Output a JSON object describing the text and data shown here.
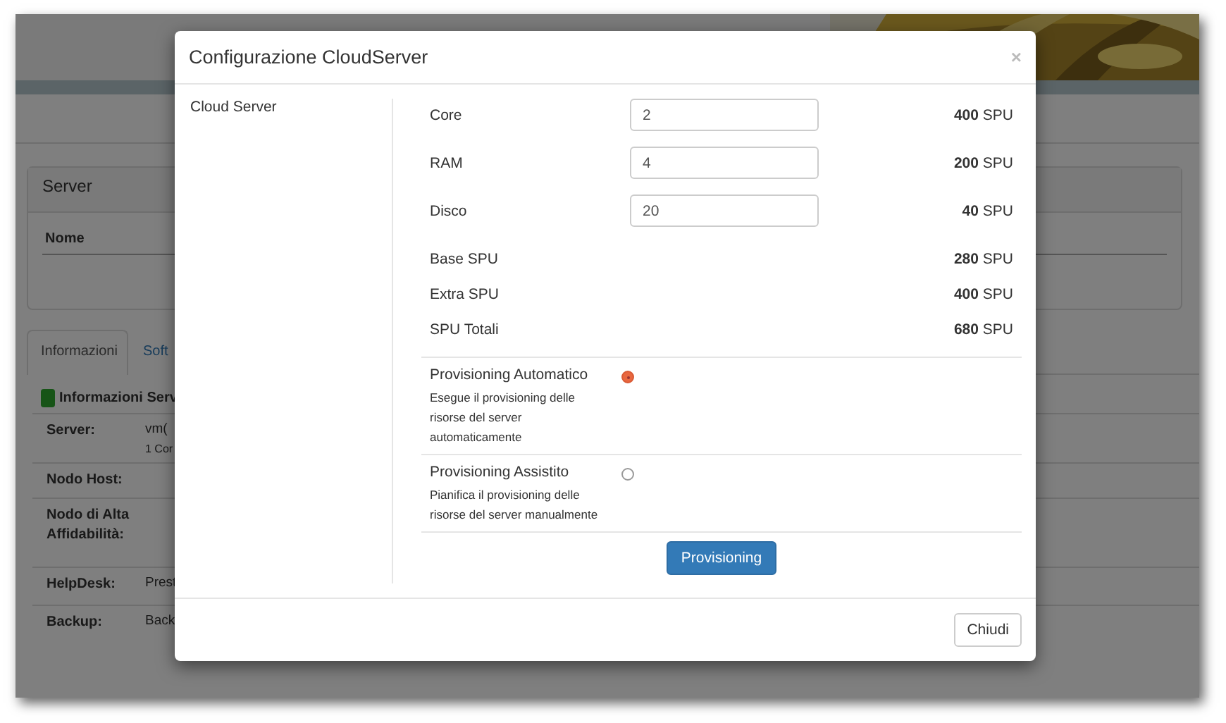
{
  "background": {
    "server_panel": {
      "title": "Server",
      "columns": [
        "Nome"
      ]
    },
    "tabs": [
      {
        "label": "Informazioni",
        "selected": true
      },
      {
        "label": "Soft",
        "selected": false
      }
    ],
    "section_title": "Informazioni Serv",
    "details": [
      {
        "label": "Server:",
        "value": "vm(",
        "note": "1 Cor"
      },
      {
        "label": "Nodo Host:"
      },
      {
        "label": "Nodo di Alta Affidabilità:"
      },
      {
        "label": "HelpDesk:",
        "value": "Prest"
      },
      {
        "label": "Backup:",
        "value": "Back"
      }
    ]
  },
  "modal": {
    "title": "Configurazione CloudServer",
    "close": "×",
    "sidebar_items": [
      "Cloud Server"
    ],
    "resources": [
      {
        "label": "Core",
        "value": "2",
        "amount": "400",
        "unit": "SPU"
      },
      {
        "label": "RAM",
        "value": "4",
        "amount": "200",
        "unit": "SPU"
      },
      {
        "label": "Disco",
        "value": "20",
        "amount": "40",
        "unit": "SPU"
      }
    ],
    "totals": [
      {
        "label": "Base SPU",
        "amount": "280",
        "unit": "SPU"
      },
      {
        "label": "Extra SPU",
        "amount": "400",
        "unit": "SPU"
      },
      {
        "label": "SPU Totali",
        "amount": "680",
        "unit": "SPU"
      }
    ],
    "provisioning_options": [
      {
        "title": "Provisioning Automatico",
        "description": "Esegue il provisioning delle risorse del server automaticamente",
        "selected": true
      },
      {
        "title": "Provisioning Assistito",
        "description": "Pianifica il provisioning delle risorse del server manualmente",
        "selected": false
      }
    ],
    "submit": "Provisioning",
    "footer_button": "Chiudi"
  }
}
